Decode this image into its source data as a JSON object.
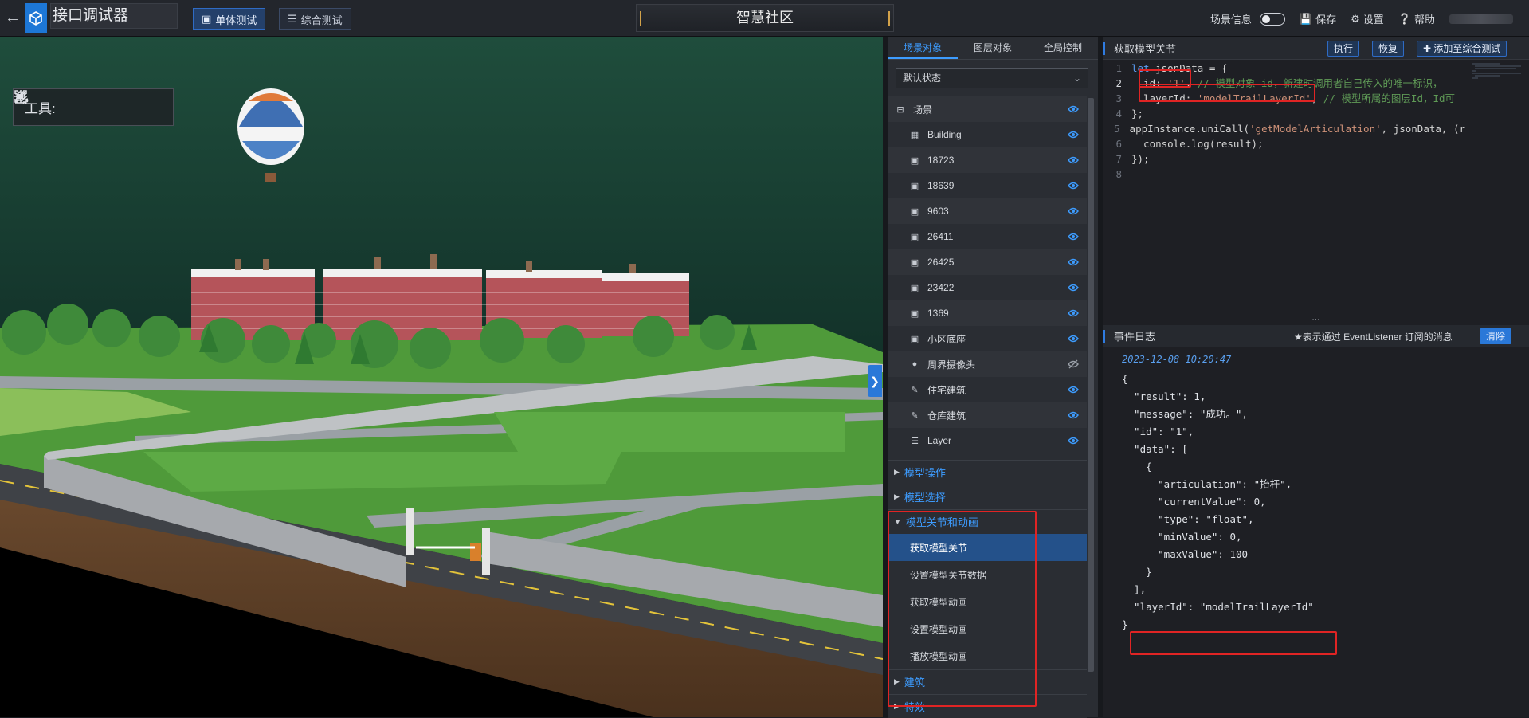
{
  "header": {
    "back_icon": "arrow-left-icon",
    "app_title": "接口调试器",
    "mode_single": "单体测试",
    "mode_combined": "综合测试",
    "center_title": "智慧社区",
    "scene_info": "场景信息",
    "save": "保存",
    "settings": "设置",
    "help": "帮助"
  },
  "viewport": {
    "tools_label": "工具:",
    "tool_icons": [
      "locate-icon",
      "frame-select-icon",
      "pen-icon",
      "gear-cluster-icon"
    ]
  },
  "left_panel": {
    "tabs": [
      "场景对象",
      "图层对象",
      "全局控制"
    ],
    "state_select": "默认状态",
    "tree": [
      {
        "label": "场景",
        "icon": "minus-box-icon",
        "root": true
      },
      {
        "label": "Building",
        "icon": "building-icon"
      },
      {
        "label": "18723",
        "icon": "cube-icon"
      },
      {
        "label": "18639",
        "icon": "cube-icon"
      },
      {
        "label": "9603",
        "icon": "cube-icon"
      },
      {
        "label": "26411",
        "icon": "cube-icon"
      },
      {
        "label": "26425",
        "icon": "cube-icon"
      },
      {
        "label": "23422",
        "icon": "cube-icon"
      },
      {
        "label": "1369",
        "icon": "cube-icon"
      },
      {
        "label": "小区底座",
        "icon": "cube-icon"
      },
      {
        "label": "周界摄像头",
        "icon": "pin-icon"
      },
      {
        "label": "住宅建筑",
        "icon": "pencil-icon"
      },
      {
        "label": "仓库建筑",
        "icon": "pencil-icon"
      },
      {
        "label": "Layer",
        "icon": "layer-icon"
      }
    ],
    "sections": {
      "model_ops": "模型操作",
      "model_select": "模型选择",
      "model_joints": "模型关节和动画",
      "building": "建筑",
      "effects": "特效"
    },
    "joint_items": [
      "获取模型关节",
      "设置模型关节数据",
      "获取模型动画",
      "设置模型动画",
      "播放模型动画"
    ]
  },
  "code_panel": {
    "title": "获取模型关节",
    "run": "执行",
    "restore": "恢复",
    "add_to": "添加至综合测试",
    "line_numbers": [
      "1",
      "2",
      "3",
      "4",
      "5",
      "6",
      "7",
      "8"
    ],
    "code": {
      "l1_kw": "let",
      "l1_rest": " jsonData = {",
      "l2_prop": "  id: ",
      "l2_str": "'1'",
      "l2_comma": ",",
      "l2_cmt": " // 模型对象 id，新建时调用者自己传入的唯一标识，",
      "l3_prop": "  layerId: ",
      "l3_str": "'modelTrailLayerId'",
      "l3_comma": ",",
      "l3_cmt": " // 模型所属的图层Id，Id可",
      "l4": "};",
      "l5_a": "appInstance.uniCall(",
      "l5_str": "'getModelArticulation'",
      "l5_b": ", jsonData, (r",
      "l6": "  console.log(result);",
      "l7": "});",
      "l8": ""
    }
  },
  "log_panel": {
    "title": "事件日志",
    "hint": "★表示通过 EventListener 订阅的消息",
    "clear": "清除",
    "timestamp": "2023-12-08 10:20:47",
    "lines": [
      "{",
      "  \"result\": 1,",
      "  \"message\": \"成功。\",",
      "  \"id\": \"1\",",
      "  \"data\": [",
      "    {",
      "      \"articulation\": \"抬杆\",",
      "      \"currentValue\": 0,",
      "      \"type\": \"float\",",
      "      \"minValue\": 0,",
      "      \"maxValue\": 100",
      "    }",
      "  ],",
      "  \"layerId\": \"modelTrailLayerId\"",
      "}"
    ]
  },
  "colors": {
    "accent": "#3d9cff",
    "highlight_box": "#e02424",
    "active_item": "#24518a"
  }
}
